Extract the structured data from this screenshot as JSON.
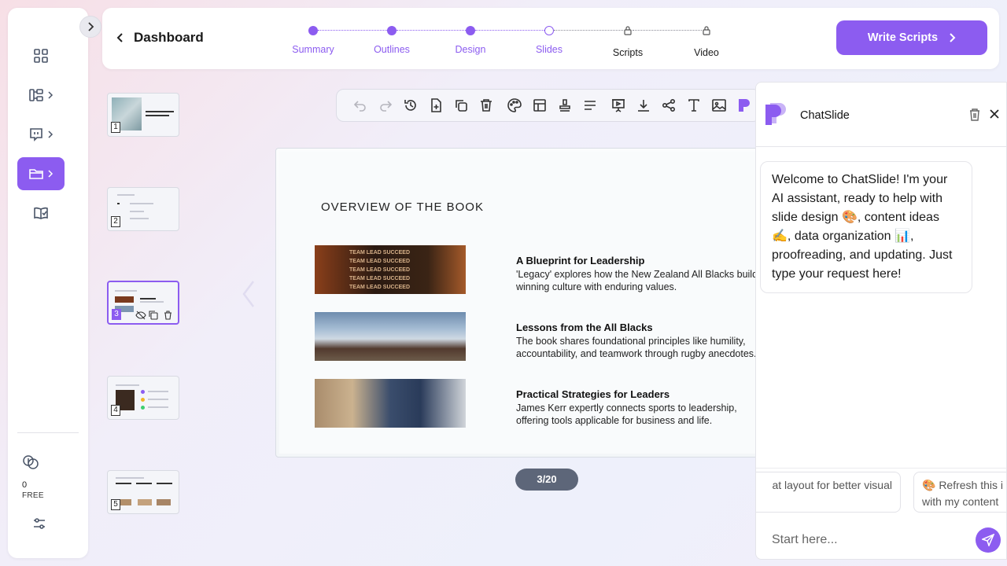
{
  "header": {
    "back_label": "Dashboard",
    "steps": [
      {
        "label": "Summary",
        "state": "done"
      },
      {
        "label": "Outlines",
        "state": "done"
      },
      {
        "label": "Design",
        "state": "done"
      },
      {
        "label": "Slides",
        "state": "current"
      },
      {
        "label": "Scripts",
        "state": "locked"
      },
      {
        "label": "Video",
        "state": "locked"
      }
    ],
    "write_button": "Write Scripts"
  },
  "sidebar": {
    "items": [
      {
        "name": "dashboard",
        "icon": "grid-icon"
      },
      {
        "name": "templates",
        "icon": "tree-icon"
      },
      {
        "name": "social",
        "icon": "chat-bubble-icon"
      },
      {
        "name": "projects",
        "icon": "folder-icon",
        "active": true
      },
      {
        "name": "resources",
        "icon": "book-check-icon"
      }
    ],
    "credits": "0",
    "plan": "FREE"
  },
  "thumbnails": [
    {
      "number": "1"
    },
    {
      "number": "2"
    },
    {
      "number": "3",
      "active": true
    },
    {
      "number": "4"
    },
    {
      "number": "5"
    }
  ],
  "slide": {
    "title": "OVERVIEW OF THE BOOK",
    "image_text": "TEAM LEAD SUCCEED",
    "blocks": [
      {
        "heading": "A Blueprint for Leadership",
        "body": "'Legacy' explores how the New Zealand All Blacks build a winning culture with enduring values."
      },
      {
        "heading": "Lessons from the All Blacks",
        "body": "The book shares foundational principles like humility, accountability, and teamwork through rugby anecdotes."
      },
      {
        "heading": "Practical Strategies for Leaders",
        "body": "James Kerr expertly connects sports to leadership, offering tools applicable for business and life."
      }
    ],
    "page_indicator": "3/20"
  },
  "chat": {
    "title": "ChatSlide",
    "welcome": "Welcome to ChatSlide! I'm your AI assistant, ready to help with slide design 🎨, content ideas ✍️, data organization 📊, proofreading, and updating. Just type your request here!",
    "suggestions": [
      "at layout for better visual",
      "🎨 Refresh this i with my content"
    ],
    "input_placeholder": "Start here..."
  },
  "colors": {
    "accent": "#8c5cf0",
    "page_pill": "#5d6679"
  }
}
